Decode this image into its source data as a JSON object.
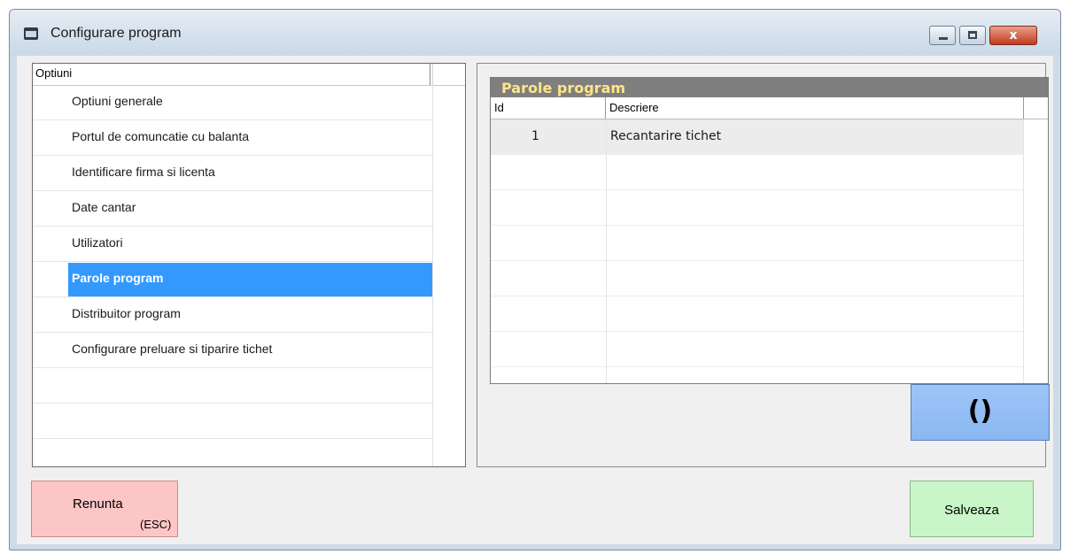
{
  "window": {
    "title": "Configurare program",
    "icons": {
      "app": "calendar-app-icon",
      "minimize": "minimize-icon",
      "maximize": "maximize-icon",
      "close": "close-icon"
    },
    "close_glyph": "x"
  },
  "options_panel": {
    "header": "Optiuni",
    "items": [
      {
        "label": "Optiuni generale",
        "selected": false
      },
      {
        "label": "Portul de comuncatie cu balanta",
        "selected": false
      },
      {
        "label": "Identificare firma si licenta",
        "selected": false
      },
      {
        "label": "Date cantar",
        "selected": false
      },
      {
        "label": "Utilizatori",
        "selected": false
      },
      {
        "label": "Parole program",
        "selected": true
      },
      {
        "label": "Distribuitor program",
        "selected": false
      },
      {
        "label": "Configurare preluare si tiparire tichet",
        "selected": false
      }
    ]
  },
  "passwords_grid": {
    "title": "Parole program",
    "columns": [
      "Id",
      "Descriere"
    ],
    "rows": [
      {
        "id": "1",
        "descriere": "Recantarire tichet"
      }
    ]
  },
  "action_button": {
    "label": "()"
  },
  "footer": {
    "cancel_label": "Renunta",
    "cancel_hint": "(ESC)",
    "save_label": "Salveaza"
  },
  "colors": {
    "selection": "#3399ff",
    "grid_title_bg": "#7f7f7f",
    "grid_title_text": "#ffe58a",
    "cancel_bg": "#fcc6c6",
    "save_bg": "#c9f6c9",
    "action_bg": "#9dc5f7"
  }
}
